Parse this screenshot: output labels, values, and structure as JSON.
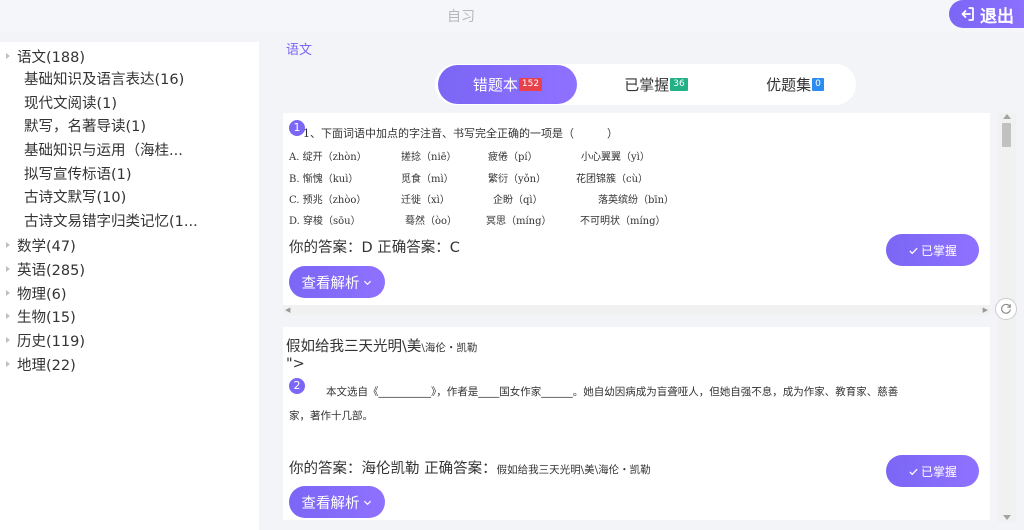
{
  "header": {
    "title": "自习",
    "exit_label": "退出"
  },
  "sidebar": {
    "subjects": [
      {
        "label": "语文(188)",
        "children": [
          "基础知识及语言表达(16)",
          "现代文阅读(1)",
          "默写，名著导读(1)",
          "基础知识与运用（海桂...",
          "拟写宣传标语(1)",
          "古诗文默写(10)",
          "古诗文易错字归类记忆(1..."
        ]
      },
      {
        "label": "数学(47)"
      },
      {
        "label": "英语(285)"
      },
      {
        "label": "物理(6)"
      },
      {
        "label": "生物(15)"
      },
      {
        "label": "历史(119)"
      },
      {
        "label": "地理(22)"
      }
    ]
  },
  "main": {
    "subject_title": "语文",
    "tabs": [
      {
        "label": "错题本",
        "count": "152",
        "badge_color": "#e8414b",
        "active": true
      },
      {
        "label": "已掌握",
        "count": "36",
        "badge_color": "#23b085",
        "active": false
      },
      {
        "label": "优题集",
        "count": "0",
        "badge_color": "#2d8cf0",
        "active": false
      }
    ],
    "questions": [
      {
        "number": "1",
        "stem": "1、下面词语中加点的字注音、书写完全正确的一项是（　　　）",
        "options": [
          [
            "A. 绽开（zhòn）",
            "搓捻（niē）",
            "疲倦（pí）",
            "小心翼翼（yì）"
          ],
          [
            "B. 惭愧（kuì）",
            "觅食（mì）",
            "繁衍（yǒn）",
            "花团锦簇（cù）"
          ],
          [
            "C. 预兆（zhòo）",
            "迁徙（xì）",
            "企盼（qì）",
            "落英缤纷（bīn）"
          ],
          [
            "D. 穿梭（sōu）",
            "蓦然（òo）",
            "冥思（míng）",
            "不可明状（míng）"
          ]
        ],
        "your_answer_label": "你的答案：",
        "your_answer": "D",
        "correct_answer_label": "正确答案：",
        "correct_answer": "C",
        "mastered_label": "已掌握",
        "analysis_label": "查看解析"
      },
      {
        "number": "2",
        "title": "假如给我三天光明\\美",
        "title_small": "\\海伦・凯勒",
        "title_tail": "\">",
        "stem_line1": "本文选自《__________》，作者是____国女作家______。她自幼因病成为盲聋哑人，但她自强不息，成为作家、教育家、慈善",
        "stem_line2": "家，著作十几部。",
        "your_answer_label": "你的答案：",
        "your_answer": "海伦凯勒",
        "correct_answer_label": "正确答案：",
        "correct_answer": "假如给我三天光明\\美\\海伦・凯勒",
        "mastered_label": "已掌握",
        "analysis_label": "查看解析"
      }
    ]
  },
  "colors": {
    "accent": "#7b66f5",
    "background": "#f3f4f8"
  }
}
